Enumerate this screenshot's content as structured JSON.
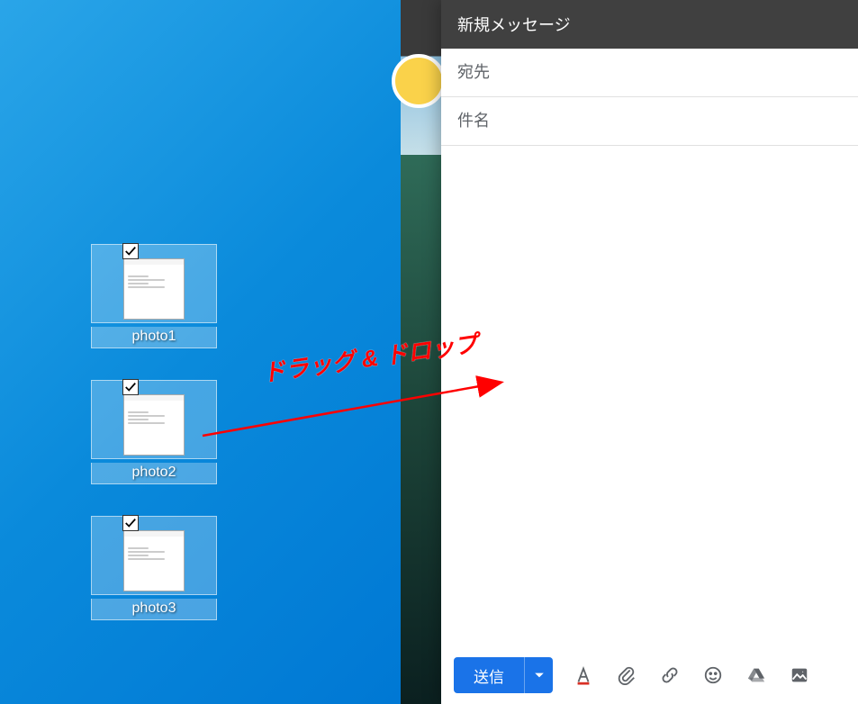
{
  "desktop": {
    "icons": [
      {
        "label": "photo1"
      },
      {
        "label": "photo2"
      },
      {
        "label": "photo3"
      }
    ]
  },
  "compose": {
    "title": "新規メッセージ",
    "to_placeholder": "宛先",
    "subject_placeholder": "件名",
    "send_label": "送信"
  },
  "toolbar_icons": {
    "format": "format-text-icon",
    "attach": "attach-file-icon",
    "link": "insert-link-icon",
    "emoji": "insert-emoji-icon",
    "drive": "insert-drive-icon",
    "image": "insert-image-icon"
  },
  "annotation": {
    "text": "ドラッグ & ドロップ"
  }
}
